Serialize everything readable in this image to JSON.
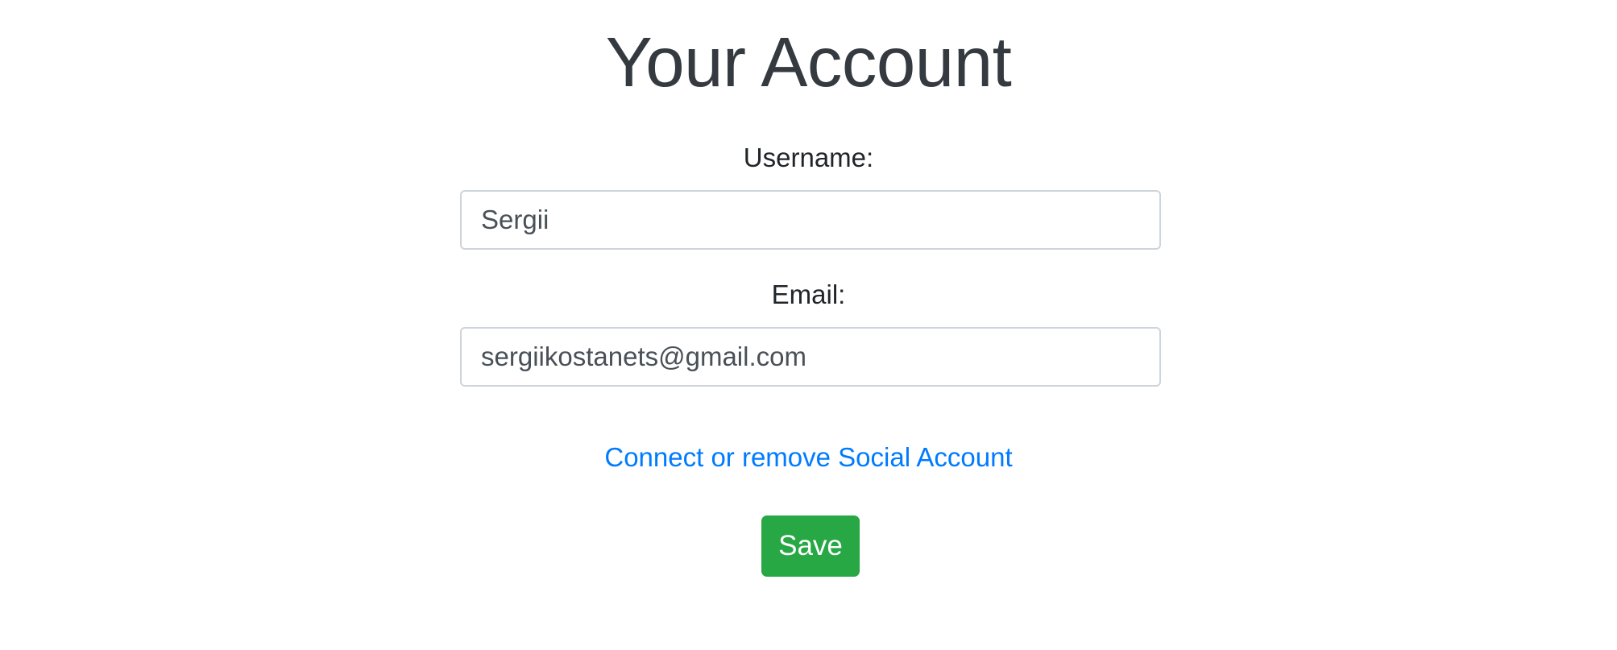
{
  "page": {
    "title": "Your Account"
  },
  "form": {
    "username": {
      "label": "Username:",
      "value": "Sergii"
    },
    "email": {
      "label": "Email:",
      "value": "sergiikostanets@gmail.com"
    },
    "social_link_label": "Connect or remove Social Account",
    "save_label": "Save"
  },
  "colors": {
    "title": "#343a40",
    "link": "#007bff",
    "save_button": "#28a745",
    "input_border": "#ced4da"
  }
}
